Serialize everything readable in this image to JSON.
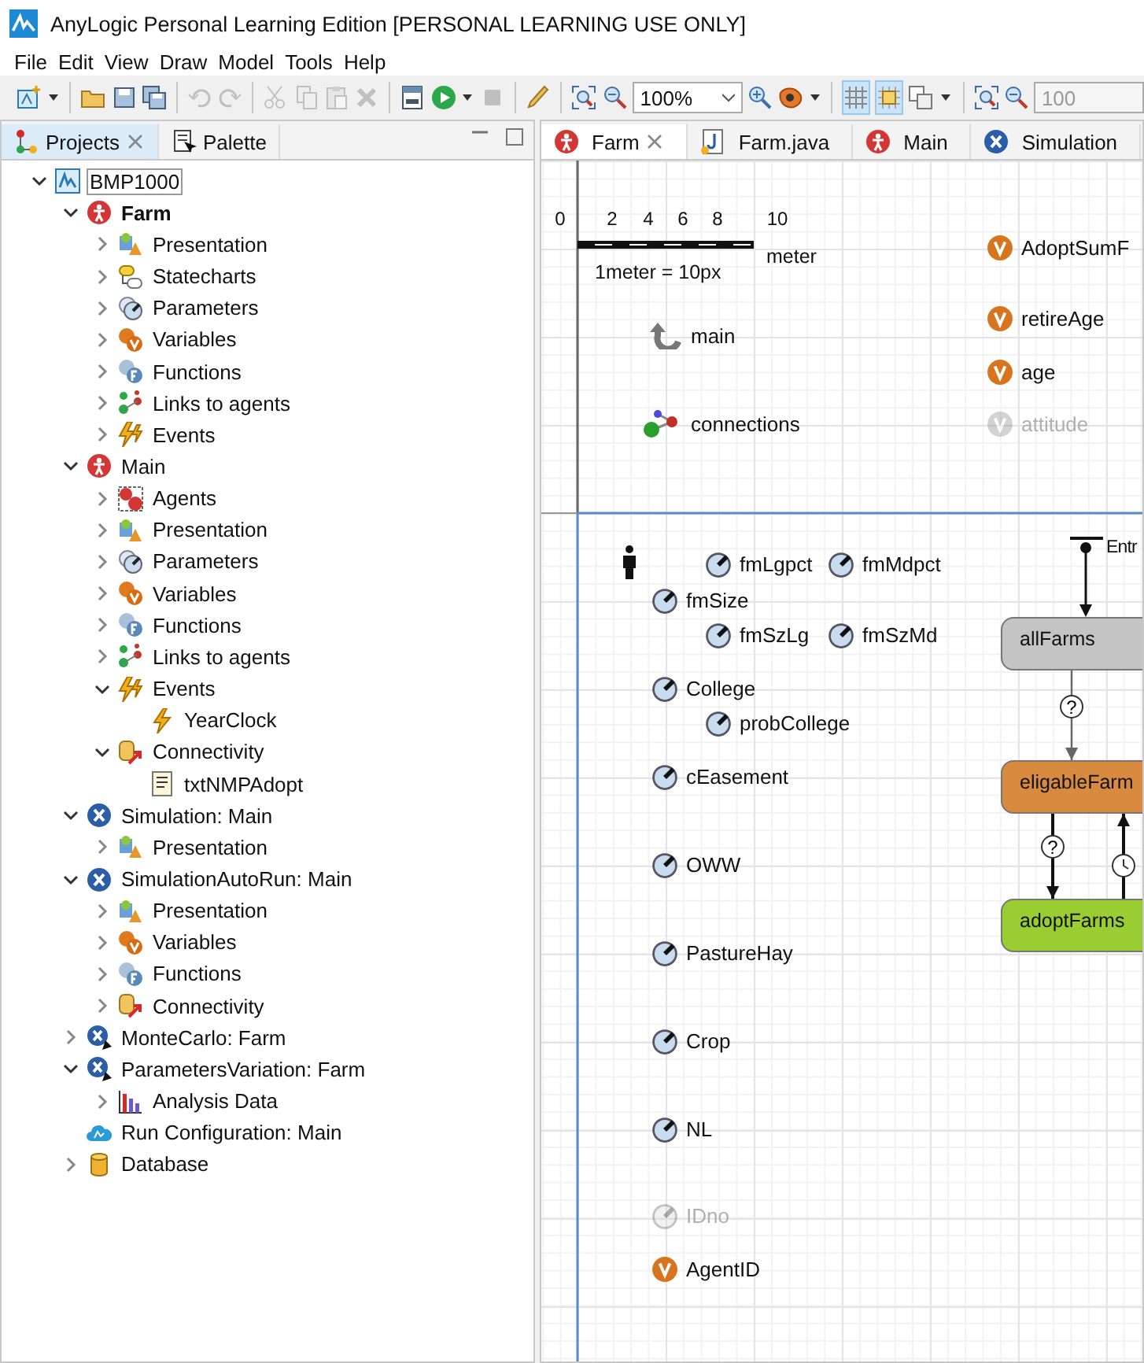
{
  "window": {
    "title": "AnyLogic Personal Learning Edition [PERSONAL LEARNING USE ONLY]"
  },
  "menu": [
    "File",
    "Edit",
    "View",
    "Draw",
    "Model",
    "Tools",
    "Help"
  ],
  "toolbar": [
    {
      "kind": "new",
      "disabled": false
    },
    {
      "kind": "dropdown",
      "disabled": false
    },
    {
      "kind": "separator"
    },
    {
      "kind": "open",
      "disabled": false
    },
    {
      "kind": "save",
      "disabled": false
    },
    {
      "kind": "saveall",
      "disabled": false
    },
    {
      "kind": "separator"
    },
    {
      "kind": "undo",
      "disabled": true
    },
    {
      "kind": "redo",
      "disabled": true
    },
    {
      "kind": "separator"
    },
    {
      "kind": "cut",
      "disabled": true
    },
    {
      "kind": "copy",
      "disabled": true
    },
    {
      "kind": "paste",
      "disabled": true
    },
    {
      "kind": "delete",
      "disabled": true
    },
    {
      "kind": "separator"
    },
    {
      "kind": "build",
      "disabled": false
    },
    {
      "kind": "run",
      "disabled": false
    },
    {
      "kind": "dropdown",
      "disabled": false
    },
    {
      "kind": "stop",
      "disabled": true
    },
    {
      "kind": "separator"
    },
    {
      "kind": "brush",
      "disabled": false
    },
    {
      "kind": "separator"
    },
    {
      "kind": "zoomfit",
      "disabled": false
    },
    {
      "kind": "zoomout",
      "disabled": false
    },
    {
      "kind": "combo",
      "value": "100%",
      "disabled": false
    },
    {
      "kind": "zoomin",
      "disabled": false
    },
    {
      "kind": "agent",
      "disabled": false
    },
    {
      "kind": "dropdown",
      "disabled": false
    },
    {
      "kind": "separator"
    },
    {
      "kind": "grid",
      "disabled": false,
      "on": true
    },
    {
      "kind": "snap",
      "disabled": false,
      "on": true
    },
    {
      "kind": "layers",
      "disabled": false,
      "on": false
    },
    {
      "kind": "dropdown",
      "disabled": false
    },
    {
      "kind": "separator"
    },
    {
      "kind": "zoomfit",
      "disabled": false
    },
    {
      "kind": "zoomout",
      "disabled": false
    },
    {
      "kind": "combo",
      "value": "100",
      "disabled": true
    }
  ],
  "left_tabs": [
    {
      "label": "Projects",
      "selected": true,
      "closable": true
    },
    {
      "label": "Palette",
      "selected": false,
      "closable": false
    }
  ],
  "tree": {
    "items": [
      {
        "label": "BMP1000",
        "kind": "model",
        "expanded": true,
        "focused": true,
        "children": [
          {
            "label": "Farm",
            "kind": "agent",
            "expanded": true,
            "bold": true,
            "children": [
              {
                "label": "Presentation",
                "kind": "presentation",
                "expanded": false
              },
              {
                "label": "Statecharts",
                "kind": "statecharts",
                "expanded": false
              },
              {
                "label": "Parameters",
                "kind": "parameters",
                "expanded": false
              },
              {
                "label": "Variables",
                "kind": "variables",
                "expanded": false
              },
              {
                "label": "Functions",
                "kind": "functions",
                "expanded": false
              },
              {
                "label": "Links to agents",
                "kind": "links",
                "expanded": false
              },
              {
                "label": "Events",
                "kind": "events",
                "expanded": false
              }
            ]
          },
          {
            "label": "Main",
            "kind": "agent",
            "expanded": true,
            "children": [
              {
                "label": "Agents",
                "kind": "agents",
                "expanded": false
              },
              {
                "label": "Presentation",
                "kind": "presentation",
                "expanded": false
              },
              {
                "label": "Parameters",
                "kind": "parameters",
                "expanded": false
              },
              {
                "label": "Variables",
                "kind": "variables",
                "expanded": false
              },
              {
                "label": "Functions",
                "kind": "functions",
                "expanded": false
              },
              {
                "label": "Links to agents",
                "kind": "links",
                "expanded": false
              },
              {
                "label": "Events",
                "kind": "events",
                "expanded": true,
                "children": [
                  {
                    "label": "YearClock",
                    "kind": "event"
                  }
                ]
              },
              {
                "label": "Connectivity",
                "kind": "connectivity",
                "expanded": true,
                "children": [
                  {
                    "label": "txtNMPAdopt",
                    "kind": "textfile"
                  }
                ]
              }
            ]
          },
          {
            "label": "Simulation: Main",
            "kind": "experiment",
            "expanded": true,
            "children": [
              {
                "label": "Presentation",
                "kind": "presentation",
                "expanded": false
              }
            ]
          },
          {
            "label": "SimulationAutoRun: Main",
            "kind": "experiment",
            "expanded": true,
            "children": [
              {
                "label": "Presentation",
                "kind": "presentation",
                "expanded": false
              },
              {
                "label": "Variables",
                "kind": "variables",
                "expanded": false
              },
              {
                "label": "Functions",
                "kind": "functions",
                "expanded": false
              },
              {
                "label": "Connectivity",
                "kind": "connectivity",
                "expanded": false
              }
            ]
          },
          {
            "label": "MonteCarlo: Farm",
            "kind": "experiment2",
            "expanded": false
          },
          {
            "label": "ParametersVariation: Farm",
            "kind": "experiment2",
            "expanded": true,
            "children": [
              {
                "label": "Analysis Data",
                "kind": "chart",
                "expanded": false
              }
            ]
          },
          {
            "label": "Run Configuration: Main",
            "kind": "runconfig"
          },
          {
            "label": "Database",
            "kind": "database",
            "expanded": false
          }
        ]
      }
    ]
  },
  "editor_tabs": [
    {
      "label": "Farm",
      "kind": "agent",
      "selected": true,
      "closable": true
    },
    {
      "label": "Farm.java",
      "kind": "java",
      "selected": false,
      "closable": false
    },
    {
      "label": "Main",
      "kind": "agent",
      "selected": false,
      "closable": false
    },
    {
      "label": "Simulation",
      "kind": "experiment",
      "selected": false,
      "closable": false
    }
  ],
  "canvas": {
    "scale": {
      "ticks": [
        "0",
        "2",
        "4",
        "6",
        "8",
        "10"
      ],
      "unit": "meter",
      "caption": "1meter = 10px"
    },
    "elements": [
      {
        "kind": "link",
        "label": "main",
        "disabled": false
      },
      {
        "kind": "connections",
        "label": "connections",
        "disabled": false
      },
      {
        "kind": "variable",
        "label": "AdoptSumF",
        "disabled": false
      },
      {
        "kind": "variable",
        "label": "retireAge",
        "disabled": false
      },
      {
        "kind": "variable",
        "label": "age",
        "disabled": false
      },
      {
        "kind": "variable",
        "label": "attitude",
        "disabled": true
      },
      {
        "kind": "person"
      },
      {
        "kind": "parameter",
        "label": "fmLgpct",
        "disabled": false
      },
      {
        "kind": "parameter",
        "label": "fmMdpct",
        "disabled": false
      },
      {
        "kind": "parameter",
        "label": "fmSize",
        "disabled": false
      },
      {
        "kind": "parameter",
        "label": "fmSzLg",
        "disabled": false
      },
      {
        "kind": "parameter",
        "label": "fmSzMd",
        "disabled": false
      },
      {
        "kind": "parameter",
        "label": "College",
        "disabled": false
      },
      {
        "kind": "parameter",
        "label": "probCollege",
        "disabled": false
      },
      {
        "kind": "parameter",
        "label": "cEasement",
        "disabled": false
      },
      {
        "kind": "parameter",
        "label": "OWW",
        "disabled": false
      },
      {
        "kind": "parameter",
        "label": "PastureHay",
        "disabled": false
      },
      {
        "kind": "parameter",
        "label": "Crop",
        "disabled": false
      },
      {
        "kind": "parameter",
        "label": "NL",
        "disabled": false
      },
      {
        "kind": "parameter",
        "label": "IDno",
        "disabled": true
      },
      {
        "kind": "variable",
        "label": "AgentID",
        "disabled": false
      }
    ],
    "statechart": {
      "entry_label": "Entr",
      "states": [
        {
          "label": "allFarms",
          "color": "#c4c4c4"
        },
        {
          "label": "eligableFarm",
          "color": "#d88a3f"
        },
        {
          "label": "adoptFarms",
          "color": "#9acd32"
        }
      ],
      "transitions": [
        {
          "kind": "condition",
          "symbol": "?"
        },
        {
          "kind": "condition",
          "symbol": "?"
        },
        {
          "kind": "timeout"
        }
      ]
    }
  }
}
